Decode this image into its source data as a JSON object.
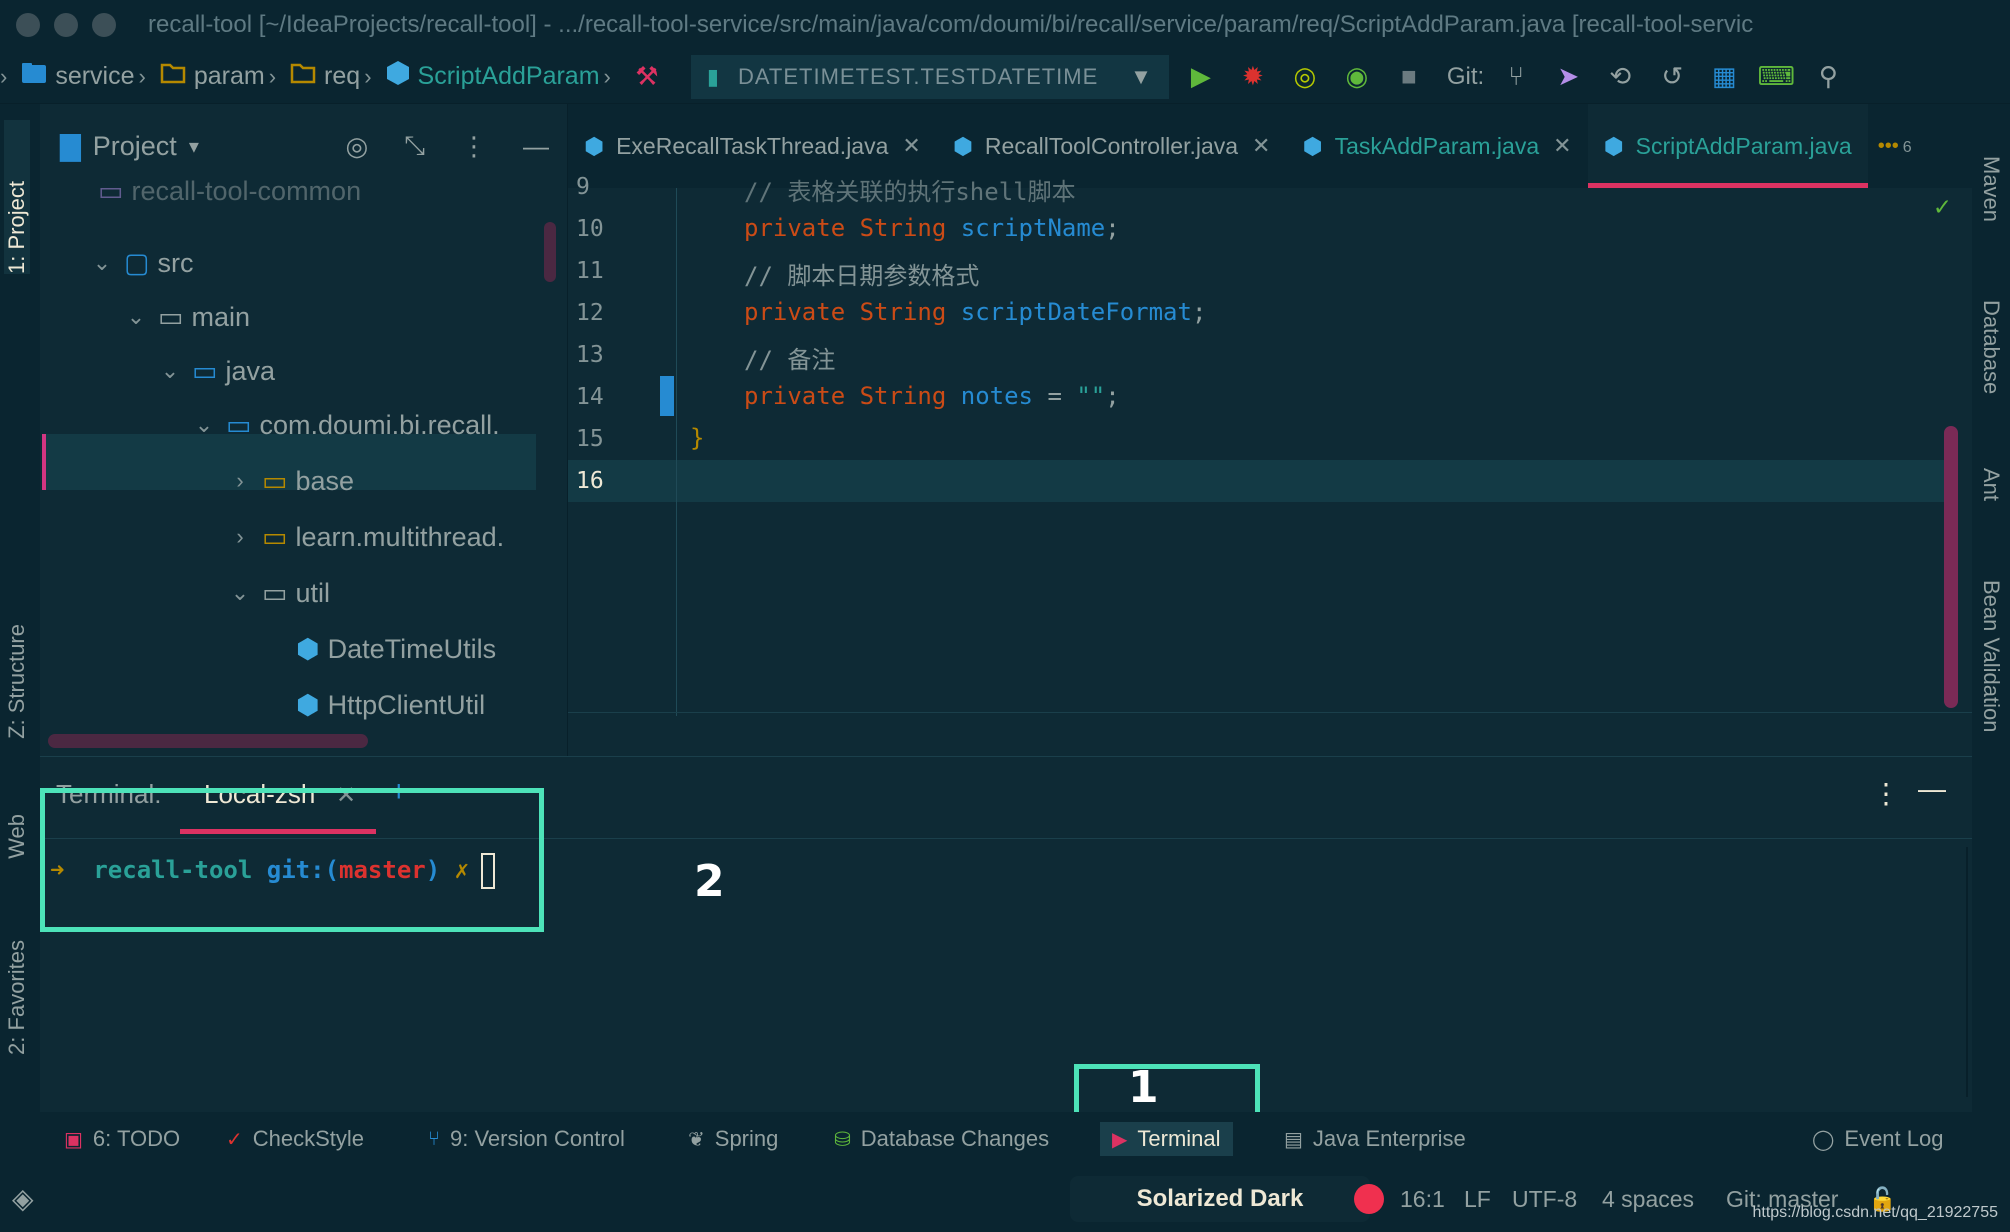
{
  "window": {
    "title": "recall-tool [~/IdeaProjects/recall-tool] - .../recall-tool-service/src/main/java/com/doumi/bi/recall/service/param/req/ScriptAddParam.java [recall-tool-servic"
  },
  "breadcrumbs": [
    "service",
    "param",
    "req",
    "ScriptAddParam"
  ],
  "run_config": "DATETIMETEST.TESTDATETIME",
  "toolbar": {
    "git_label": "Git:"
  },
  "left_tabs": [
    "1: Project",
    "Z: Structure",
    "Web",
    "2: Favorites"
  ],
  "right_tabs": [
    "Maven",
    "Database",
    "Ant",
    "Bean Validation"
  ],
  "project": {
    "header": "Project",
    "tree": [
      {
        "label": "recall-tool-common",
        "icon": "module-icon"
      },
      {
        "label": "src",
        "icon": "source-folder-icon"
      },
      {
        "label": "main",
        "icon": "folder-icon"
      },
      {
        "label": "java",
        "icon": "folder-icon"
      },
      {
        "label": "com.doumi.bi.recall.",
        "icon": "package-icon"
      },
      {
        "label": "base",
        "icon": "folder-icon"
      },
      {
        "label": "learn.multithread.",
        "icon": "folder-icon"
      },
      {
        "label": "util",
        "icon": "folder-icon"
      },
      {
        "label": "DateTimeUtils",
        "icon": "class-icon"
      },
      {
        "label": "HttpClientUtil",
        "icon": "class-icon"
      }
    ]
  },
  "tabs": [
    {
      "label": "ExeRecallTaskThread.java"
    },
    {
      "label": "RecallToolController.java"
    },
    {
      "label": "TaskAddParam.java"
    },
    {
      "label": "ScriptAddParam.java"
    }
  ],
  "tabs_more_count": "6",
  "editor": {
    "line_numbers": [
      "9",
      "10",
      "11",
      "12",
      "13",
      "14",
      "15",
      "16"
    ],
    "lines": {
      "l9": "// 表格关联的执行shell脚本",
      "l10_kw": "private String ",
      "l10_id": "scriptName",
      "l11": "// 脚本日期参数格式",
      "l12_kw": "private String ",
      "l12_id": "scriptDateFormat",
      "l13": "// 备注",
      "l14_kw": "private String ",
      "l14_id": "notes",
      "l14_eq": " = ",
      "l14_str": "\"\"",
      "semicolon": ";",
      "l15": "}"
    }
  },
  "terminal": {
    "title": "Terminal:",
    "tab": "Local-zsh",
    "prompt_arrow": "➜",
    "prompt_dir": "recall-tool",
    "prompt_git": "git:(",
    "prompt_branch": "master",
    "prompt_close": ")",
    "prompt_x": "✗"
  },
  "annotations": {
    "box1": "1",
    "box2": "2"
  },
  "tool_tabs": [
    {
      "label": "6: TODO"
    },
    {
      "label": "CheckStyle"
    },
    {
      "label": "9: Version Control"
    },
    {
      "label": "Spring"
    },
    {
      "label": "Database Changes"
    },
    {
      "label": "Terminal"
    },
    {
      "label": "Java Enterprise"
    },
    {
      "label": "Event Log"
    }
  ],
  "status": {
    "theme": "Solarized Dark",
    "position": "16:1",
    "line_sep": "LF",
    "encoding": "UTF-8",
    "indent": "4 spaces",
    "git": "Git: master",
    "watermark": "https://blog.csdn.net/qq_21922755"
  },
  "colors": {
    "background": "#0e2a35",
    "accent_pink": "#dc3262",
    "highlight_box": "#4de3b9",
    "keyword": "#cb4b16",
    "identifier": "#268bd2",
    "string": "#2aa198"
  }
}
